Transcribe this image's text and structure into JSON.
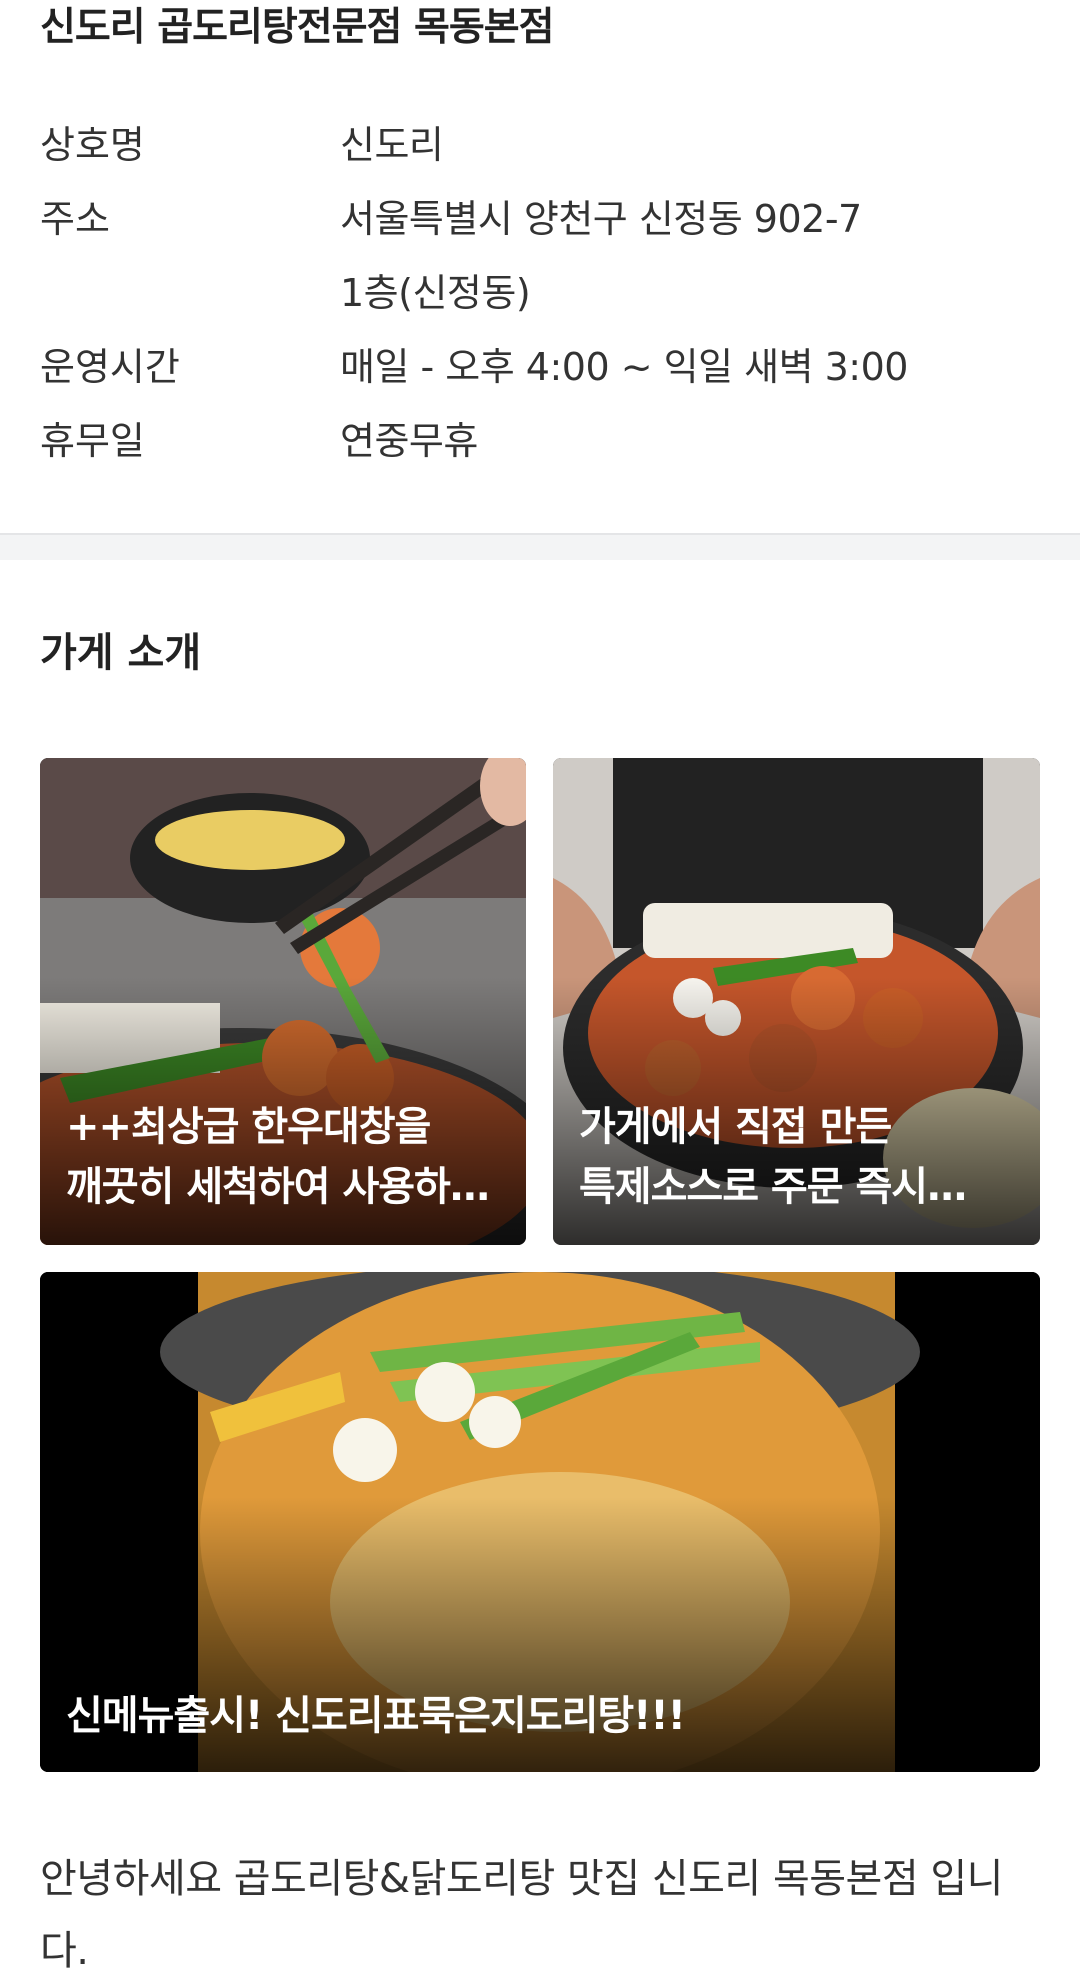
{
  "store": {
    "title": "신도리 곱도리탕전문점 목동본점",
    "info": [
      {
        "label": "상호명",
        "value": "신도리"
      },
      {
        "label": "주소",
        "value": "서울특별시 양천구 신정동 902-7\n1층(신정동)"
      },
      {
        "label": "운영시간",
        "value": "매일 - 오후 4:00 ~ 익일 새벽 3:00"
      },
      {
        "label": "휴무일",
        "value": "연중무휴"
      }
    ]
  },
  "intro": {
    "heading": "가게 소개",
    "cards": [
      {
        "caption": "++최상급 한우대창을 깨끗히 세척하여 사용하고 있습니다",
        "image": "chopsticks-lifting-gopchang-photo"
      },
      {
        "caption": "가게에서 직접 만든 특제소스로 주문 즉시 조리합니다",
        "image": "hands-holding-stew-pot-photo"
      },
      {
        "caption": "신메뉴출시! 신도리표묵은지도리탕!!!",
        "image": "kimchi-dakdoritang-pot-photo"
      }
    ],
    "text": "안녕하세요 곱도리탕&닭도리탕 맛집 신도리 목동본점 입니다."
  }
}
